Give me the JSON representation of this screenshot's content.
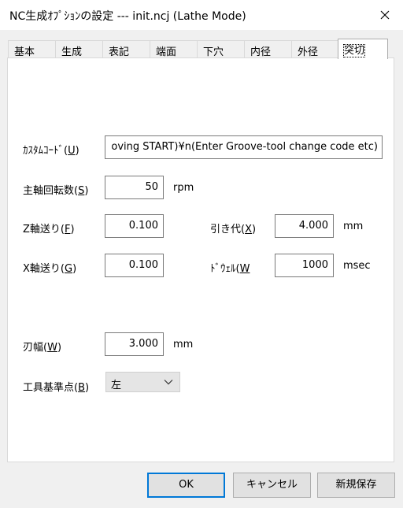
{
  "window": {
    "title": "NC生成ｵﾌﾟｼｮﾝの設定 --- init.ncj (Lathe Mode)",
    "close_icon": "close-icon"
  },
  "tabs": [
    {
      "label": "基本",
      "active": false
    },
    {
      "label": "生成",
      "active": false
    },
    {
      "label": "表記",
      "active": false
    },
    {
      "label": "端面",
      "active": false
    },
    {
      "label": "下穴",
      "active": false
    },
    {
      "label": "内径",
      "active": false
    },
    {
      "label": "外径",
      "active": false
    },
    {
      "label": "突切",
      "active": true
    }
  ],
  "form": {
    "custom_code": {
      "label": "ｶｽﾀﾑｺｰﾄﾞ",
      "key": "(U)",
      "key_letter": "U",
      "value": "oving START)¥n(Enter Groove-tool change code etc)"
    },
    "spindle_speed": {
      "label": "主軸回転数",
      "key_letter": "S",
      "value": "50",
      "unit": "rpm"
    },
    "z_feed": {
      "label": "Z軸送り",
      "key_letter": "F",
      "value": "0.100"
    },
    "pullback": {
      "label": "引き代",
      "key_letter": "X",
      "value": "4.000",
      "unit": "mm"
    },
    "x_feed": {
      "label": "X軸送り",
      "key_letter": "G",
      "value": "0.100"
    },
    "dwell": {
      "label": "ﾄﾞｳｪﾙ",
      "key_letter": "W",
      "value": "1000",
      "unit": "msec"
    },
    "blade_width": {
      "label": "刃幅",
      "key_letter": "W",
      "value": "3.000",
      "unit": "mm"
    },
    "tool_reference": {
      "label": "工具基準点",
      "key_letter": "B",
      "selected": "左"
    }
  },
  "buttons": {
    "ok": "OK",
    "cancel": "キャンセル",
    "save_new": "新規保存"
  }
}
